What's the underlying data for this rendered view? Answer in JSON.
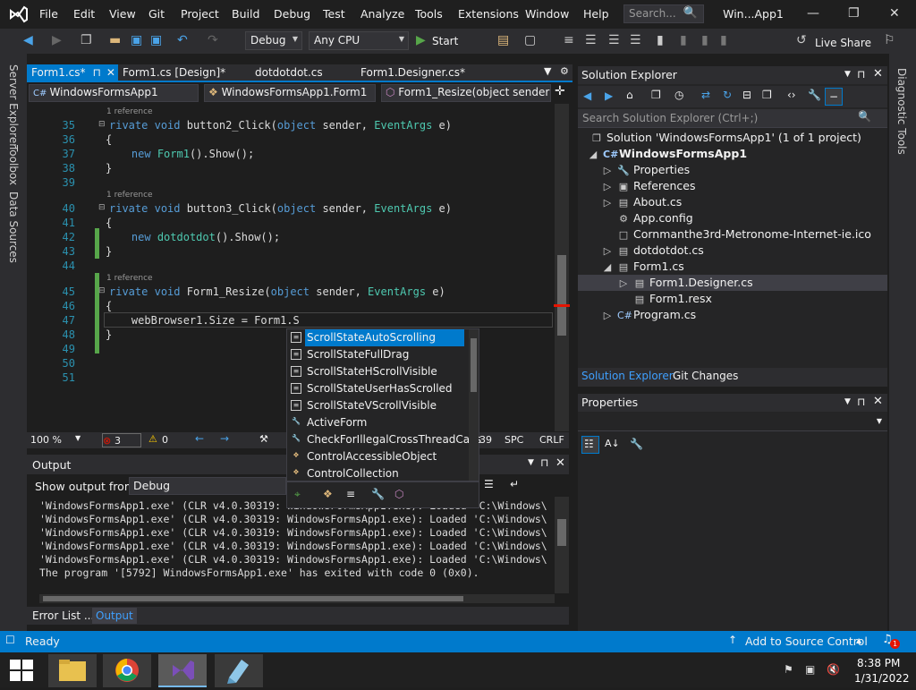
{
  "menu": [
    "File",
    "Edit",
    "View",
    "Git",
    "Project",
    "Build",
    "Debug",
    "Test",
    "Analyze",
    "Tools",
    "Extensions",
    "Window",
    "Help"
  ],
  "search_placeholder": "Search...",
  "window_title": "Win...App1",
  "toolbar": {
    "config": "Debug",
    "platform": "Any CPU",
    "start": "Start",
    "live_share": "Live Share"
  },
  "tabs": [
    "Form1.cs*",
    "Form1.cs [Design]*",
    "dotdotdot.cs",
    "Form1.Designer.cs*"
  ],
  "nav": {
    "project": "WindowsFormsApp1",
    "class": "WindowsFormsApp1.Form1",
    "member": "Form1_Resize(object sender, E"
  },
  "side_left": [
    "Server Explorer",
    "Toolbox",
    "Data Sources"
  ],
  "side_right": [
    "Diagnostic Tools"
  ],
  "code": {
    "ref": "1 reference",
    "l35": "rivate void button2_Click(object sender, EventArgs e)",
    "l36": "{",
    "l37": "    new Form1().Show();",
    "l38": "}",
    "l40": "rivate void button3_Click(object sender, EventArgs e)",
    "l42": "    new dotdotdot().Show();",
    "l45": "rivate void Form1_Resize(object sender, EventArgs e)",
    "l47": "    webBrowser1.Size = Form1.S",
    "line_numbers": [
      "35",
      "36",
      "37",
      "38",
      "39",
      "40",
      "41",
      "42",
      "43",
      "44",
      "45",
      "46",
      "47",
      "48",
      "49",
      "50",
      "51"
    ]
  },
  "editor_status": {
    "zoom": "100 %",
    "errors": "3",
    "warnings": "0",
    "col": "39",
    "spc": "SPC",
    "crlf": "CRLF"
  },
  "autocomplete": [
    "ScrollStateAutoScrolling",
    "ScrollStateFullDrag",
    "ScrollStateHScrollVisible",
    "ScrollStateUserHasScrolled",
    "ScrollStateVScrollVisible",
    "ActiveForm",
    "CheckForIllegalCrossThreadCalls",
    "ControlAccessibleObject",
    "ControlCollection"
  ],
  "output": {
    "title": "Output",
    "show_from_label": "Show output from:",
    "show_from_value": "Debug",
    "lines": [
      "'WindowsFormsApp1.exe' (CLR v4.0.30319: WindowsFormsApp1.exe): Loaded 'C:\\Windows\\",
      "'WindowsFormsApp1.exe' (CLR v4.0.30319: WindowsFormsApp1.exe): Loaded 'C:\\Windows\\",
      "'WindowsFormsApp1.exe' (CLR v4.0.30319: WindowsFormsApp1.exe): Loaded 'C:\\Windows\\",
      "'WindowsFormsApp1.exe' (CLR v4.0.30319: WindowsFormsApp1.exe): Loaded 'C:\\Windows\\",
      "'WindowsFormsApp1.exe' (CLR v4.0.30319: WindowsFormsApp1.exe): Loaded 'C:\\Windows\\",
      "The program '[5792] WindowsFormsApp1.exe' has exited with code 0 (0x0)."
    ]
  },
  "bottom_tabs": [
    "Error List ...",
    "Output"
  ],
  "solution_explorer": {
    "title": "Solution Explorer",
    "search": "Search Solution Explorer (Ctrl+;)",
    "solution": "Solution 'WindowsFormsApp1' (1 of 1 project)",
    "project": "WindowsFormsApp1",
    "items": [
      "Properties",
      "References",
      "About.cs",
      "App.config",
      "Cornmanthe3rd-Metronome-Internet-ie.ico",
      "dotdotdot.cs",
      "Form1.cs",
      "Form1.Designer.cs",
      "Form1.resx",
      "Program.cs"
    ],
    "tabs": [
      "Solution Explorer",
      "Git Changes"
    ]
  },
  "properties_title": "Properties",
  "status": {
    "ready": "Ready",
    "source_control": "Add to Source Control",
    "notifications": "1"
  },
  "clock": {
    "time": "8:38 PM",
    "date": "1/31/2022"
  },
  "colors": {
    "accent": "#007acc",
    "bg": "#1e1e1e",
    "panel": "#252526"
  }
}
